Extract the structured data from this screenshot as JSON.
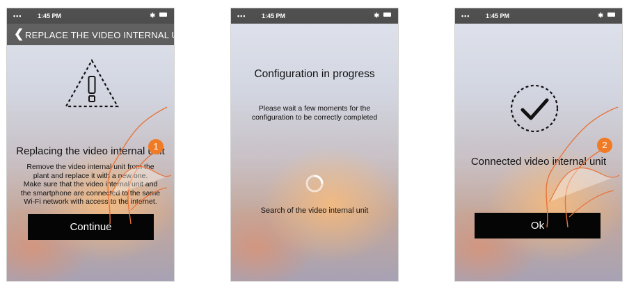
{
  "status_bar": {
    "signal": "•••",
    "time": "1:45 PM",
    "bluetooth": "✱"
  },
  "screen1": {
    "nav": {
      "back_icon": "chevron-left-icon",
      "title": "REPLACE THE VIDEO INTERNAL UNIT"
    },
    "warning_icon": "warning-triangle-icon",
    "heading": "Replacing the video internal unit",
    "body_lines": [
      "Remove the video internal unit from the",
      "plant and replace it with a new one.",
      "Make sure that the video internal unit and",
      "the smartphone are connected to the same",
      "Wi-Fi network with access to the internet."
    ],
    "button_label": "Continue",
    "step_badge": "1"
  },
  "screen2": {
    "heading": "Configuration in progress",
    "body_lines": [
      "Please wait a few moments for the",
      "configuration to be correctly completed"
    ],
    "spinner_icon": "loading-spinner-icon",
    "status_text": "Search of the video internal unit"
  },
  "screen3": {
    "check_icon": "checkmark-circle-icon",
    "heading": "Connected video internal unit",
    "button_label": "Ok",
    "step_badge": "2"
  },
  "colors": {
    "accent": "#f07b26",
    "button": "#050505",
    "navbar": "#444444",
    "statusbar": "#2b2b2b"
  }
}
